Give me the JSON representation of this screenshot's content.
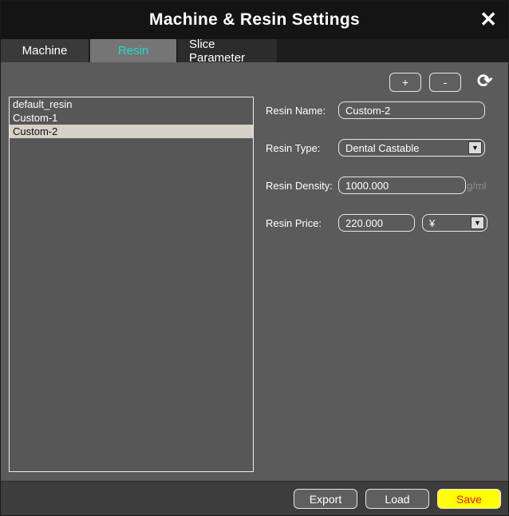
{
  "window": {
    "title": "Machine & Resin Settings",
    "close_icon": "✕"
  },
  "tabs": [
    {
      "label": "Machine",
      "active": false
    },
    {
      "label": "Resin",
      "active": true
    },
    {
      "label": "Slice Parameter",
      "active": false
    }
  ],
  "resin_list": {
    "items": [
      "default_resin",
      "Custom-1",
      "Custom-2"
    ],
    "selected": "Custom-2"
  },
  "toolbar": {
    "add_label": "+",
    "remove_label": "-",
    "refresh_icon": "⟳"
  },
  "form": {
    "resin_name": {
      "label": "Resin Name:",
      "value": "Custom-2"
    },
    "resin_type": {
      "label": "Resin Type:",
      "value": "Dental Castable",
      "arrow": "▼"
    },
    "resin_density": {
      "label": "Resin Density:",
      "value": "1000.000",
      "unit": "g/ml"
    },
    "resin_price": {
      "label": "Resin Price:",
      "value": "220.000",
      "currency": "¥",
      "arrow": "▼"
    }
  },
  "footer": {
    "export_label": "Export",
    "load_label": "Load",
    "save_label": "Save"
  },
  "colors": {
    "accent_tab_text": "#1ce0c8",
    "selected_item_bg": "#d6d1c6",
    "save_bg": "#ffff00",
    "save_text": "#ee1111",
    "titlebar_bg": "#141414",
    "main_bg": "#5b5b5b"
  }
}
